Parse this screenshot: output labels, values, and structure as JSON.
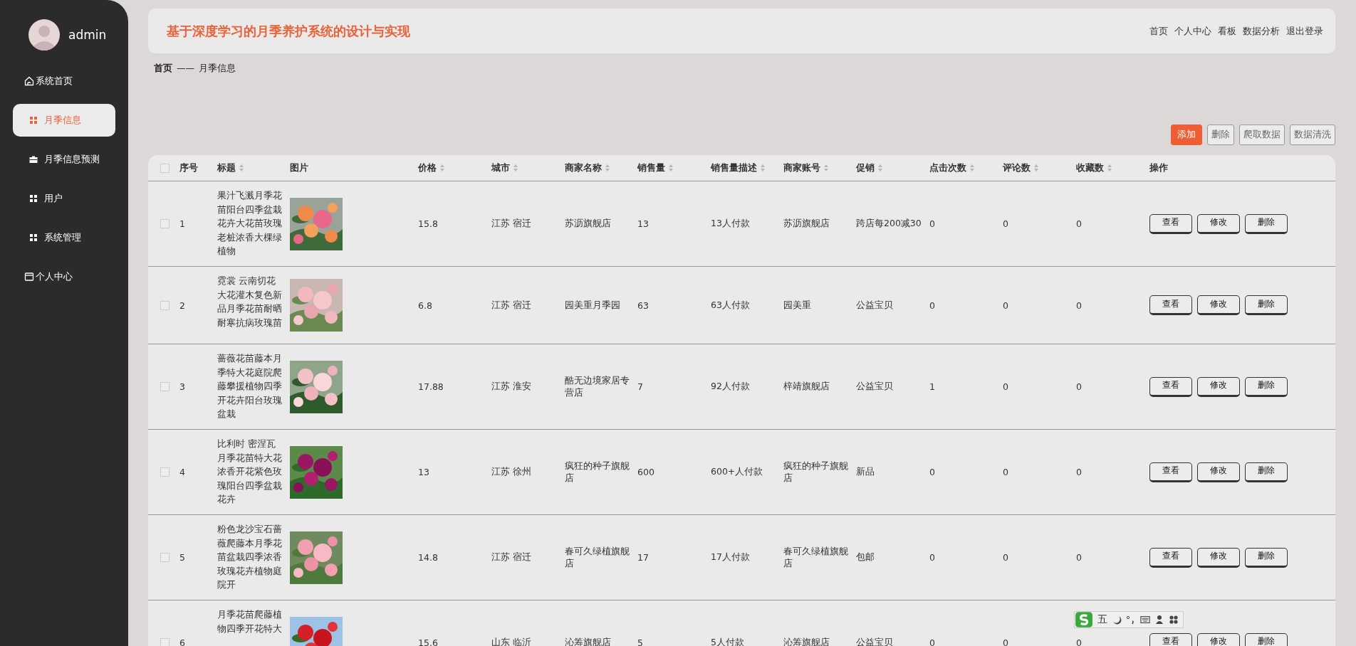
{
  "sidebar": {
    "user": "admin",
    "items": [
      {
        "label": "系统首页",
        "kind": "home",
        "selected": false
      },
      {
        "label": "月季信息",
        "kind": "grid",
        "selected": true
      },
      {
        "label": "月季信息预测",
        "kind": "case",
        "selected": false
      },
      {
        "label": "用户",
        "kind": "grid",
        "selected": false
      },
      {
        "label": "系统管理",
        "kind": "grid",
        "selected": false
      },
      {
        "label": "个人中心",
        "kind": "panel",
        "selected": false
      }
    ]
  },
  "header": {
    "title": "基于深度学习的月季养护系统的设计与实现",
    "links": [
      "首页",
      "个人中心",
      "看板",
      "数据分析",
      "退出登录"
    ]
  },
  "breadcrumb": {
    "home": "首页",
    "separator": "——",
    "current": "月季信息"
  },
  "toolbar": [
    {
      "label": "添加",
      "kind": "primary"
    },
    {
      "label": "删除",
      "kind": "default"
    },
    {
      "label": "爬取数据",
      "kind": "default"
    },
    {
      "label": "数据清洗",
      "kind": "default"
    }
  ],
  "table": {
    "select_all": {
      "checked": false
    },
    "columns": [
      {
        "label": "序号",
        "sortable": false
      },
      {
        "label": "标题",
        "sortable": true
      },
      {
        "label": "图片",
        "sortable": false
      },
      {
        "label": "价格",
        "sortable": true
      },
      {
        "label": "城市",
        "sortable": true
      },
      {
        "label": "商家名称",
        "sortable": true
      },
      {
        "label": "销售量",
        "sortable": true
      },
      {
        "label": "销售量描述",
        "sortable": true
      },
      {
        "label": "商家账号",
        "sortable": true
      },
      {
        "label": "促销",
        "sortable": true
      },
      {
        "label": "点击次数",
        "sortable": true
      },
      {
        "label": "评论数",
        "sortable": true
      },
      {
        "label": "收藏数",
        "sortable": true
      },
      {
        "label": "操作",
        "sortable": false
      }
    ],
    "rows": [
      {
        "checked": false,
        "index": "1",
        "title": "果汁飞溅月季花苗阳台四季盆栽花卉大花苗玫瑰老桩浓香大棵绿植物",
        "image": {
          "kind": "picture"
        },
        "price": "15.8",
        "city": "江苏 宿迁",
        "shop": "苏沥旗舰店",
        "sales": "13",
        "sales_desc": "13人付款",
        "account": "苏沥旗舰店",
        "promo": "跨店每200减30",
        "clicks": "0",
        "comments": "0",
        "favorites": "0",
        "actions": [
          "查看",
          "修改",
          "删除"
        ]
      },
      {
        "checked": false,
        "index": "2",
        "title": "霓裳 云南切花大花灌木复色新品月季花苗耐晒耐寒抗病玫瑰苗",
        "image": {
          "kind": "picture"
        },
        "price": "6.8",
        "city": "江苏 宿迁",
        "shop": "园美重月季园",
        "sales": "63",
        "sales_desc": "63人付款",
        "account": "园美重",
        "promo": "公益宝贝",
        "clicks": "0",
        "comments": "0",
        "favorites": "0",
        "actions": [
          "查看",
          "修改",
          "删除"
        ]
      },
      {
        "checked": false,
        "index": "3",
        "title": "蔷薇花苗藤本月季特大花庭院爬藤攀援植物四季开花卉阳台玫瑰盆栽",
        "image": {
          "kind": "picture"
        },
        "price": "17.88",
        "city": "江苏 淮安",
        "shop": "酷无边境家居专营店",
        "sales": "7",
        "sales_desc": "92人付款",
        "account": "梓靖旗舰店",
        "promo": "公益宝贝",
        "clicks": "1",
        "comments": "0",
        "favorites": "0",
        "actions": [
          "查看",
          "修改",
          "删除"
        ]
      },
      {
        "checked": false,
        "index": "4",
        "title": "比利时 密涅瓦月季花苗特大花浓香开花紫色玫瑰阳台四季盆栽花卉",
        "image": {
          "kind": "picture"
        },
        "price": "13",
        "city": "江苏 徐州",
        "shop": "疯狂的种子旗舰店",
        "sales": "600",
        "sales_desc": "600+人付款",
        "account": "疯狂的种子旗舰店",
        "promo": "新品",
        "clicks": "0",
        "comments": "0",
        "favorites": "0",
        "actions": [
          "查看",
          "修改",
          "删除"
        ]
      },
      {
        "checked": false,
        "index": "5",
        "title": "粉色龙沙宝石蔷薇爬藤本月季花苗盆栽四季浓香玫瑰花卉植物庭院开",
        "image": {
          "kind": "picture"
        },
        "price": "14.8",
        "city": "江苏 宿迁",
        "shop": "春可久绿植旗舰店",
        "sales": "17",
        "sales_desc": "17人付款",
        "account": "春可久绿植旗舰店",
        "promo": "包邮",
        "clicks": "0",
        "comments": "0",
        "favorites": "0",
        "actions": [
          "查看",
          "修改",
          "删除"
        ]
      },
      {
        "checked": false,
        "index": "6",
        "title": "月季花苗爬藤植物四季开花特大",
        "image": {
          "kind": "picture"
        },
        "price": "15.6",
        "city": "山东 临沂",
        "shop": "沁筹旗舰店",
        "sales": "5",
        "sales_desc": "5人付款",
        "account": "沁筹旗舰店",
        "promo": "公益宝贝",
        "clicks": "0",
        "comments": "0",
        "favorites": "0",
        "actions": [
          "查看",
          "修改",
          "删除"
        ]
      }
    ]
  },
  "ime_toolbar": {
    "mode": "五"
  }
}
